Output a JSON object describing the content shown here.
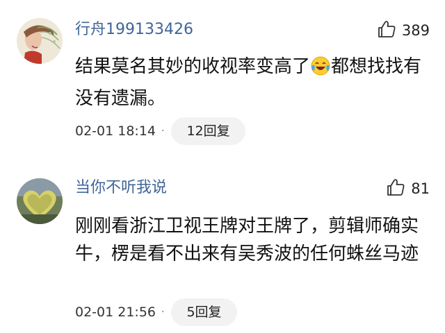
{
  "comments": [
    {
      "username": "行舟199133426",
      "likes": "389",
      "text_before_emoji": "结果莫名其妙的收视率变高了",
      "emoji": "laughing-crying-emoji",
      "text_after_emoji": "都想找找有没有遗漏。",
      "date": "02-01 18:14",
      "separator": "·",
      "replies": "12回复"
    },
    {
      "username": "当你不听我说",
      "likes": "81",
      "text": "刚刚看浙江卫视王牌对王牌了，剪辑师确实牛，楞是看不出来有吴秀波的任何蛛丝马迹",
      "date": "02-01 21:56",
      "separator": "·",
      "replies": "5回复"
    }
  ],
  "colors": {
    "username": "#406599",
    "text": "#111111",
    "reply_bg": "#f2f2f2"
  }
}
